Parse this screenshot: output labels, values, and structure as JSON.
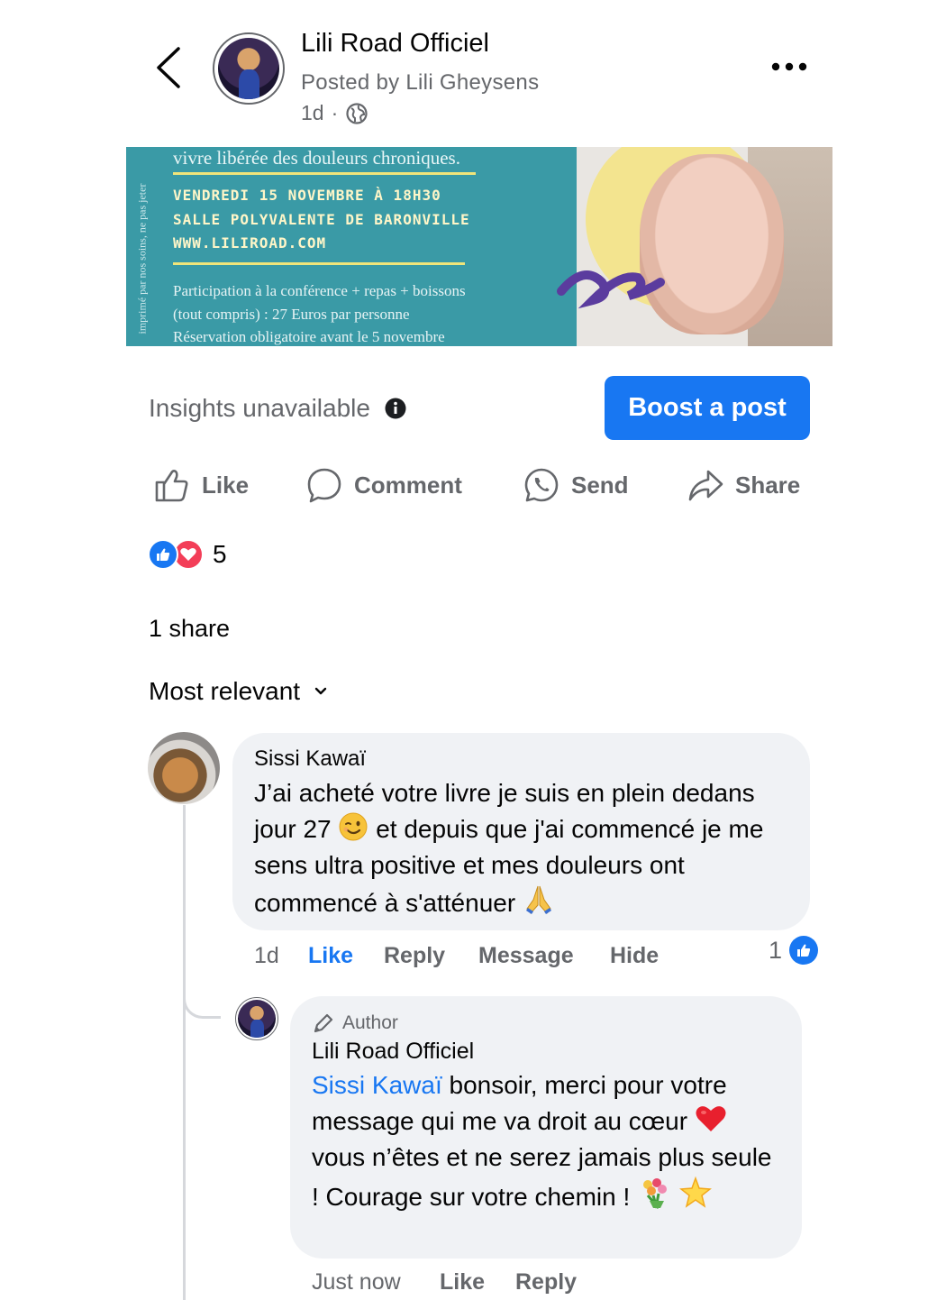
{
  "header": {
    "page_name": "Lili Road Officiel",
    "posted_by": "Posted by Lili Gheysens",
    "time": "1d",
    "separator": "·"
  },
  "banner": {
    "side_text": "imprimé par nos soins, ne pas jeter",
    "line1": "vivre libérée des douleurs chroniques.",
    "event_date": "VENDREDI 15 NOVEMBRE À 18H30",
    "event_place": "SALLE POLYVALENTE DE BARONVILLE",
    "event_site": "WWW.LILIROAD.COM",
    "price_line1": "Participation à la conférence + repas + boissons",
    "price_line2": "(tout compris) : 27 Euros par personne",
    "price_line3": "Réservation obligatoire avant le 5 novembre"
  },
  "insights": {
    "label": "Insights unavailable",
    "boost_label": "Boost a post"
  },
  "actions": {
    "like": "Like",
    "comment": "Comment",
    "send": "Send",
    "share": "Share"
  },
  "reactions": {
    "count": "5"
  },
  "shares": "1 share",
  "sort": {
    "label": "Most relevant"
  },
  "comment1": {
    "name": "Sissi Kawaï",
    "text_part1": "J’ai acheté votre livre je suis en plein dedans jour 27",
    "text_part2": "et depuis que j'ai commencé je me sens ultra positive et mes douleurs ont commencé à s'atténuer",
    "time": "1d",
    "like": "Like",
    "reply": "Reply",
    "message": "Message",
    "hide": "Hide",
    "like_count": "1"
  },
  "reply": {
    "badge": "Author",
    "name": "Lili Road Officiel",
    "mention": "Sissi Kawaï",
    "text_part1": "bonsoir, merci pour votre message qui me va droit au cœur",
    "text_part2": "vous n’êtes et ne serez jamais plus seule ! Courage sur votre chemin !",
    "time": "Just now",
    "like": "Like",
    "reply": "Reply"
  },
  "colors": {
    "accent": "#1877f2",
    "secondary_text": "#65676b",
    "bubble": "#f0f2f5",
    "love": "#f33e58"
  },
  "icons": [
    "back-chevron-icon",
    "globe-icon",
    "more-dots-icon",
    "info-icon",
    "thumbs-up-icon",
    "comment-bubble-icon",
    "messenger-icon",
    "share-arrow-icon",
    "like-reaction-icon",
    "love-reaction-icon",
    "chevron-down-icon",
    "pen-icon"
  ]
}
